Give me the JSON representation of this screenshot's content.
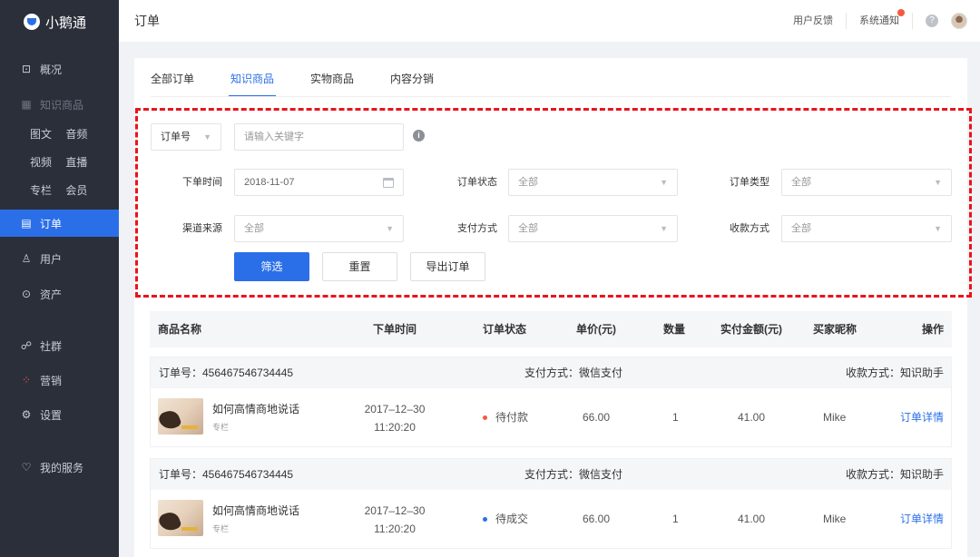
{
  "app": {
    "name": "小鹅通"
  },
  "sidebar": {
    "overview": "概况",
    "knowledge": "知识商品",
    "sub_rows": [
      [
        "图文",
        "音频"
      ],
      [
        "视频",
        "直播"
      ],
      [
        "专栏",
        "会员"
      ]
    ],
    "orders": "订单",
    "users": "用户",
    "assets": "资产",
    "community": "社群",
    "marketing": "营销",
    "settings": "设置",
    "my_service": "我的服务"
  },
  "header": {
    "title": "订单",
    "feedback": "用户反馈",
    "notice": "系统通知"
  },
  "tabs": [
    "全部订单",
    "知识商品",
    "实物商品",
    "内容分销"
  ],
  "filters": {
    "order_no_select": "订单号",
    "keyword_placeholder": "请输入关键字",
    "time_label": "下单时间",
    "time_value": "2018-11-07",
    "status_label": "订单状态",
    "status_value": "全部",
    "type_label": "订单类型",
    "type_value": "全部",
    "channel_label": "渠道来源",
    "channel_value": "全部",
    "pay_label": "支付方式",
    "pay_value": "全部",
    "receive_label": "收款方式",
    "receive_value": "全部",
    "btn_filter": "筛选",
    "btn_reset": "重置",
    "btn_export": "导出订单"
  },
  "table": {
    "headers": [
      "商品名称",
      "下单时间",
      "订单状态",
      "单价(元)",
      "数量",
      "实付金额(元)",
      "买家昵称",
      "操作"
    ],
    "orders": [
      {
        "order_no": "订单号：456467546734445",
        "pay_method": "支付方式：微信支付",
        "receive_method": "收款方式：知识助手",
        "product": "如何高情商地说话",
        "product_type": "专栏",
        "date": "2017–12–30",
        "time": "11:20:20",
        "status": "待付款",
        "status_color": "#f5593d",
        "price": "66.00",
        "qty": "1",
        "paid": "41.00",
        "buyer": "Mike",
        "action": "订单详情"
      },
      {
        "order_no": "订单号：456467546734445",
        "pay_method": "支付方式：微信支付",
        "receive_method": "收款方式：知识助手",
        "product": "如何高情商地说话",
        "product_type": "专栏",
        "date": "2017–12–30",
        "time": "11:20:20",
        "status": "待成交",
        "status_color": "#2b6fe8",
        "price": "66.00",
        "qty": "1",
        "paid": "41.00",
        "buyer": "Mike",
        "action": "订单详情"
      }
    ]
  }
}
